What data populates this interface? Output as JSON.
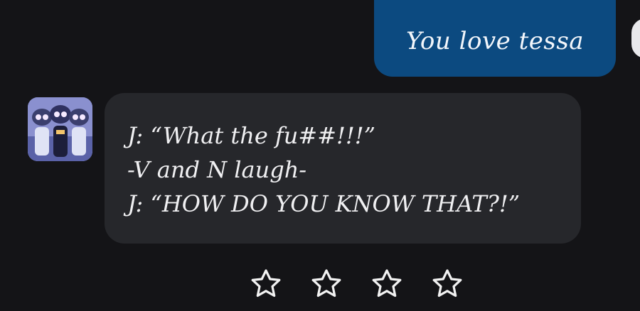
{
  "conversation": {
    "user_message": {
      "text": "You love tessa"
    },
    "bot_message": {
      "lines": [
        "J: “What the fu##!!!”",
        "-V and N laugh-",
        "J: “HOW DO YOU KNOW THAT?!”"
      ]
    }
  },
  "rating": {
    "stars_total": 4,
    "stars_filled": 0,
    "icon": "star-outline-icon"
  },
  "colors": {
    "background": "#141417",
    "user_bubble": "#0c4a80",
    "bot_bubble": "#26272b",
    "text": "#f0f0f2"
  }
}
